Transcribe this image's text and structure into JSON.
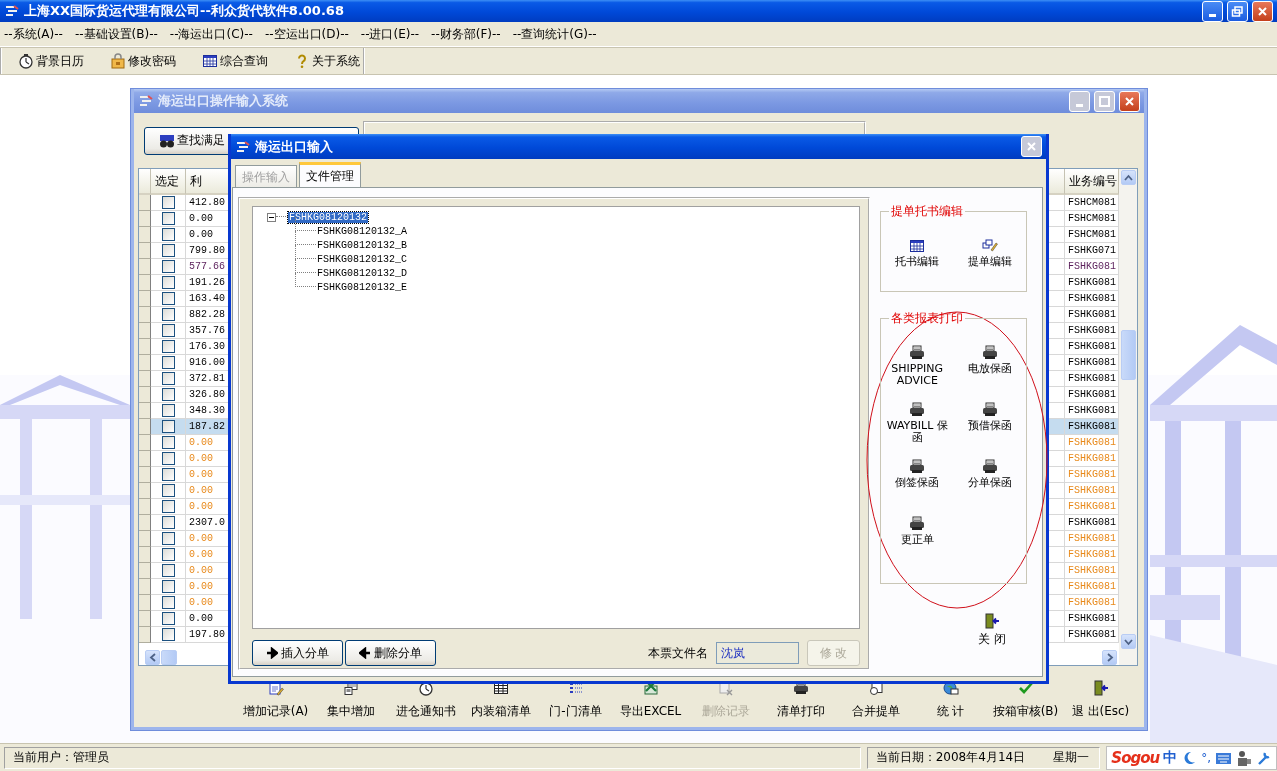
{
  "window": {
    "title": "上海XX国际货运代理有限公司--利众货代软件8.00.68"
  },
  "menu": [
    "--系统(A)--",
    "--基础设置(B)--",
    "--海运出口(C)--",
    "--空运出口(D)--",
    "--进口(E)--",
    "--财务部(F)--",
    "--查询统计(G)--"
  ],
  "toolbar": [
    "背景日历",
    "修改密码",
    "综合查询",
    "关于系统"
  ],
  "operations_window": {
    "title": "海运出口操作输入系统",
    "search_button": "查找满足",
    "columns": [
      "选定",
      "利",
      "业务编号"
    ],
    "rows": [
      {
        "checked": false,
        "amount": "412.80",
        "code": "FSHCM081",
        "color": "#000000",
        "selected": false
      },
      {
        "checked": false,
        "amount": "0.00",
        "code": "FSHCM081",
        "color": "#000000",
        "selected": false
      },
      {
        "checked": false,
        "amount": "0.00",
        "code": "FSHCM081",
        "color": "#000000",
        "selected": false
      },
      {
        "checked": false,
        "amount": "799.80",
        "code": "FSHKG071",
        "color": "#000000",
        "selected": false
      },
      {
        "checked": false,
        "amount": "577.66",
        "code": "FSHKG081",
        "color": "#5b1f5b",
        "selected": false
      },
      {
        "checked": false,
        "amount": "191.26",
        "code": "FSHKG081",
        "color": "#000000",
        "selected": false
      },
      {
        "checked": false,
        "amount": "163.40",
        "code": "FSHKG081",
        "color": "#000000",
        "selected": false
      },
      {
        "checked": false,
        "amount": "882.28",
        "code": "FSHKG081",
        "color": "#000000",
        "selected": false
      },
      {
        "checked": false,
        "amount": "357.76",
        "code": "FSHKG081",
        "color": "#000000",
        "selected": false
      },
      {
        "checked": false,
        "amount": "176.30",
        "code": "FSHKG081",
        "color": "#000000",
        "selected": false
      },
      {
        "checked": false,
        "amount": "916.00",
        "code": "FSHKG081",
        "color": "#000000",
        "selected": false
      },
      {
        "checked": false,
        "amount": "372.81",
        "code": "FSHKG081",
        "color": "#000000",
        "selected": false
      },
      {
        "checked": false,
        "amount": "326.80",
        "code": "FSHKG081",
        "color": "#000000",
        "selected": false
      },
      {
        "checked": false,
        "amount": "348.30",
        "code": "FSHKG081",
        "color": "#000000",
        "selected": false
      },
      {
        "checked": false,
        "amount": "187.82",
        "code": "FSHKG081",
        "color": "#000000",
        "selected": true
      },
      {
        "checked": false,
        "amount": "0.00",
        "code": "FSHKG081",
        "color": "#e8891a",
        "selected": false
      },
      {
        "checked": false,
        "amount": "0.00",
        "code": "FSHKG081",
        "color": "#e8891a",
        "selected": false
      },
      {
        "checked": false,
        "amount": "0.00",
        "code": "FSHKG081",
        "color": "#e8891a",
        "selected": false
      },
      {
        "checked": false,
        "amount": "0.00",
        "code": "FSHKG081",
        "color": "#e8891a",
        "selected": false
      },
      {
        "checked": false,
        "amount": "0.00",
        "code": "FSHKG081",
        "color": "#e8891a",
        "selected": false
      },
      {
        "checked": false,
        "amount": "2307.0",
        "code": "FSHKG081",
        "color": "#000000",
        "selected": false
      },
      {
        "checked": false,
        "amount": "0.00",
        "code": "FSHKG081",
        "color": "#e8891a",
        "selected": false
      },
      {
        "checked": false,
        "amount": "0.00",
        "code": "FSHKG081",
        "color": "#e8891a",
        "selected": false
      },
      {
        "checked": false,
        "amount": "0.00",
        "code": "FSHKG081",
        "color": "#e8891a",
        "selected": false
      },
      {
        "checked": false,
        "amount": "0.00",
        "code": "FSHKG081",
        "color": "#e8891a",
        "selected": false
      },
      {
        "checked": false,
        "amount": "0.00",
        "code": "FSHKG081",
        "color": "#e8891a",
        "selected": false
      },
      {
        "checked": false,
        "amount": "0.00",
        "code": "FSHKG081",
        "color": "#000000",
        "selected": false
      },
      {
        "checked": false,
        "amount": "197.80",
        "code": "FSHKG081",
        "color": "#000000",
        "selected": false
      }
    ],
    "actions": [
      {
        "label": "增加记录(A)",
        "disabled": false
      },
      {
        "label": "集中增加",
        "disabled": false
      },
      {
        "label": "进仓通知书",
        "disabled": false
      },
      {
        "label": "内装箱清单",
        "disabled": false
      },
      {
        "label": "门-门清单",
        "disabled": false
      },
      {
        "label": "导出EXCEL",
        "disabled": false
      },
      {
        "label": "删除记录",
        "disabled": true
      },
      {
        "label": "清单打印",
        "disabled": false
      },
      {
        "label": "合并提单",
        "disabled": false
      },
      {
        "label": "统 计",
        "disabled": false
      },
      {
        "label": "按箱审核(B)",
        "disabled": false
      },
      {
        "label": "退 出(Esc)",
        "disabled": false
      }
    ]
  },
  "dialog": {
    "title": "海运出口输入",
    "tabs": [
      {
        "label": "操作输入",
        "selected": false,
        "disabled": true
      },
      {
        "label": "文件管理",
        "selected": true,
        "disabled": false
      }
    ],
    "tree": {
      "label": "FSHKG08120132",
      "selected": true,
      "expanded": true,
      "children": [
        {
          "label": "FSHKG08120132_A",
          "selected": false
        },
        {
          "label": "FSHKG08120132_B",
          "selected": false
        },
        {
          "label": "FSHKG08120132_C",
          "selected": false
        },
        {
          "label": "FSHKG08120132_D",
          "selected": false
        },
        {
          "label": "FSHKG08120132_E",
          "selected": false
        }
      ]
    },
    "buttons": [
      "插入分单",
      "删除分单"
    ],
    "file_name": {
      "label": "本票文件名",
      "value": "沈岚"
    },
    "modify_button": {
      "label": "修 改",
      "disabled": true
    },
    "groups": [
      {
        "title": "提单托书编辑",
        "items": [
          "托书编辑",
          "提单编辑"
        ]
      },
      {
        "title": "各类报表打印",
        "items": [
          "SHIPPING ADVICE",
          "电放保函",
          "WAYBILL 保函",
          "预借保函",
          "倒签保函",
          "分单保函",
          "更正单"
        ]
      }
    ],
    "close_button": "关 闭"
  },
  "status_bar": {
    "user": "当前用户：管理员",
    "date": "当前日期：2008年4月14日",
    "weekday": "星期一",
    "ime_logo": "Sogou",
    "ime_mode": "中",
    "punctuation": "°,"
  }
}
